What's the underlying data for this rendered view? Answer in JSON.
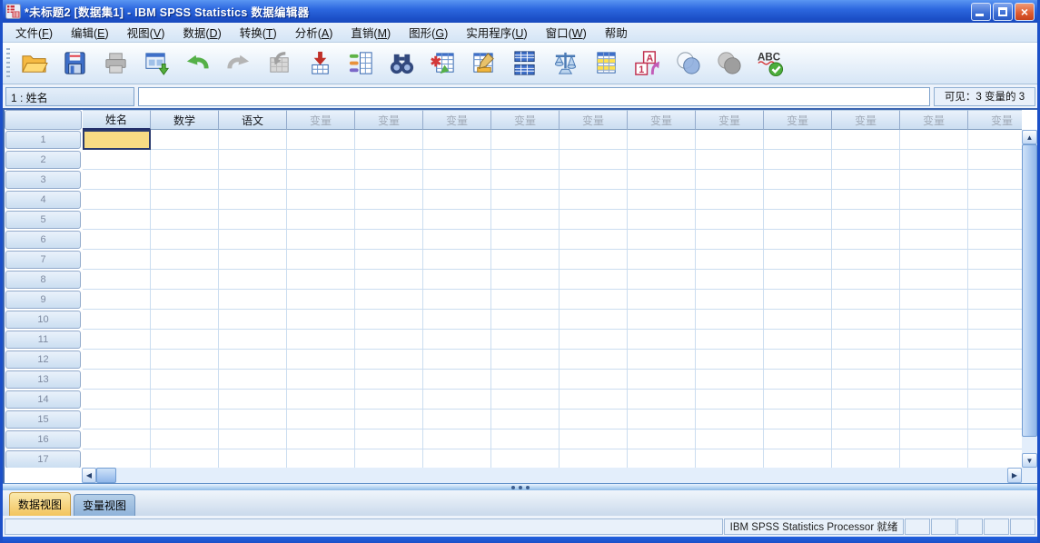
{
  "window": {
    "title": "*未标题2 [数据集1] - IBM SPSS Statistics 数据编辑器",
    "controls": [
      "minimize",
      "maximize",
      "close"
    ]
  },
  "menu": {
    "items": [
      {
        "id": "file",
        "label": "文件(F)"
      },
      {
        "id": "edit",
        "label": "编辑(E)"
      },
      {
        "id": "view",
        "label": "视图(V)"
      },
      {
        "id": "data",
        "label": "数据(D)"
      },
      {
        "id": "transform",
        "label": "转换(T)"
      },
      {
        "id": "analyze",
        "label": "分析(A)"
      },
      {
        "id": "direct-marketing",
        "label": "直销(M)"
      },
      {
        "id": "graphs",
        "label": "图形(G)"
      },
      {
        "id": "utilities",
        "label": "实用程序(U)"
      },
      {
        "id": "window",
        "label": "窗口(W)"
      },
      {
        "id": "help",
        "label": "帮助"
      }
    ]
  },
  "toolbar": {
    "icons": [
      {
        "id": "open-file",
        "disabled": false
      },
      {
        "id": "save",
        "disabled": false
      },
      {
        "id": "print",
        "disabled": true
      },
      {
        "id": "recall-dialogs",
        "disabled": false
      },
      {
        "id": "undo",
        "disabled": false
      },
      {
        "id": "redo",
        "disabled": true
      },
      {
        "id": "goto-case",
        "disabled": true
      },
      {
        "id": "goto-variable",
        "disabled": false
      },
      {
        "id": "variables",
        "disabled": false
      },
      {
        "id": "find",
        "disabled": false
      },
      {
        "id": "insert-cases",
        "disabled": false
      },
      {
        "id": "insert-variable",
        "disabled": false
      },
      {
        "id": "split-file",
        "disabled": false
      },
      {
        "id": "weight-cases",
        "disabled": false
      },
      {
        "id": "select-cases",
        "disabled": false
      },
      {
        "id": "value-labels",
        "disabled": false
      },
      {
        "id": "use-variable-sets",
        "disabled": false
      },
      {
        "id": "show-all-variables",
        "disabled": true
      },
      {
        "id": "spell-check",
        "disabled": false
      }
    ]
  },
  "cellref": {
    "label": "1 : 姓名",
    "value": "",
    "visible_info": "可见：3 变量的 3"
  },
  "grid": {
    "columns": [
      {
        "label": "姓名",
        "named": true
      },
      {
        "label": "数学",
        "named": true
      },
      {
        "label": "语文",
        "named": true
      },
      {
        "label": "变量",
        "named": false
      },
      {
        "label": "变量",
        "named": false
      },
      {
        "label": "变量",
        "named": false
      },
      {
        "label": "变量",
        "named": false
      },
      {
        "label": "变量",
        "named": false
      },
      {
        "label": "变量",
        "named": false
      },
      {
        "label": "变量",
        "named": false
      },
      {
        "label": "变量",
        "named": false
      },
      {
        "label": "变量",
        "named": false
      },
      {
        "label": "变量",
        "named": false
      },
      {
        "label": "变量",
        "named": false
      }
    ],
    "rows": [
      "1",
      "2",
      "3",
      "4",
      "5",
      "6",
      "7",
      "8",
      "9",
      "10",
      "11",
      "12",
      "13",
      "14",
      "15",
      "16",
      "17"
    ],
    "selected_cell": {
      "row_index": 0,
      "col_index": 0
    }
  },
  "tabs": [
    {
      "id": "data-view",
      "label": "数据视图",
      "active": true
    },
    {
      "id": "variable-view",
      "label": "变量视图",
      "active": false
    }
  ],
  "statusbar": {
    "message": "IBM SPSS Statistics Processor 就绪",
    "empty_cells": 5
  }
}
